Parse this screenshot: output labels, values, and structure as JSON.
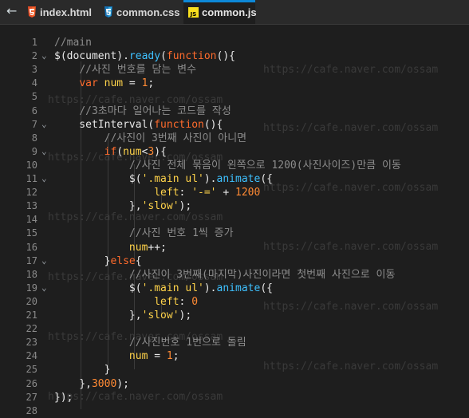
{
  "tabs": [
    {
      "label": "index.html",
      "icon": "html5-icon"
    },
    {
      "label": "common.css",
      "icon": "css3-icon"
    },
    {
      "label": "common.js",
      "icon": "js-icon",
      "active": true
    }
  ],
  "watermark": "https://cafe.naver.com/ossam",
  "lines": [
    {
      "n": "1",
      "tokens": [
        [
          "c",
          "//main"
        ]
      ]
    },
    {
      "n": "2",
      "fold": true,
      "tokens": [
        [
          "p",
          "$(document)."
        ],
        [
          "f",
          "ready"
        ],
        [
          "p",
          "("
        ],
        [
          "k",
          "function"
        ],
        [
          "p",
          "(){"
        ]
      ]
    },
    {
      "n": "3",
      "tokens": [
        [
          "p",
          "    "
        ],
        [
          "c",
          "//사진 번호를 담는 변수"
        ]
      ]
    },
    {
      "n": "4",
      "tokens": [
        [
          "p",
          "    "
        ],
        [
          "k",
          "var"
        ],
        [
          "p",
          " "
        ],
        [
          "i",
          "num"
        ],
        [
          "p",
          " = "
        ],
        [
          "n",
          "1"
        ],
        [
          "p",
          ";"
        ]
      ]
    },
    {
      "n": "5",
      "tokens": []
    },
    {
      "n": "6",
      "tokens": [
        [
          "p",
          "    "
        ],
        [
          "c",
          "//3초마다 일어나는 코드를 작성"
        ]
      ]
    },
    {
      "n": "7",
      "fold": true,
      "tokens": [
        [
          "p",
          "    setInterval("
        ],
        [
          "k",
          "function"
        ],
        [
          "p",
          "(){"
        ]
      ]
    },
    {
      "n": "8",
      "tokens": [
        [
          "p",
          "        "
        ],
        [
          "c",
          "//사진이 3번째 사진이 아니면"
        ]
      ]
    },
    {
      "n": "9",
      "fold": true,
      "tokens": [
        [
          "p",
          "        "
        ],
        [
          "k",
          "if"
        ],
        [
          "p",
          "("
        ],
        [
          "i",
          "num"
        ],
        [
          "p",
          "<"
        ],
        [
          "n",
          "3"
        ],
        [
          "p",
          "){"
        ]
      ]
    },
    {
      "n": "10",
      "tokens": [
        [
          "p",
          "            "
        ],
        [
          "c",
          "//사진 전체 묶음이 왼쪽으로 1200(사진사이즈)만큼 이동"
        ]
      ]
    },
    {
      "n": "11",
      "fold": true,
      "tokens": [
        [
          "p",
          "            $("
        ],
        [
          "s",
          "'.main ul'"
        ],
        [
          "p",
          ")."
        ],
        [
          "f",
          "animate"
        ],
        [
          "p",
          "({"
        ]
      ]
    },
    {
      "n": "12",
      "tokens": [
        [
          "p",
          "                "
        ],
        [
          "i",
          "left"
        ],
        [
          "p",
          ": "
        ],
        [
          "s",
          "'-='"
        ],
        [
          "p",
          " + "
        ],
        [
          "n",
          "1200"
        ]
      ]
    },
    {
      "n": "13",
      "tokens": [
        [
          "p",
          "            },"
        ],
        [
          "s",
          "'slow'"
        ],
        [
          "p",
          ");"
        ]
      ]
    },
    {
      "n": "14",
      "tokens": []
    },
    {
      "n": "15",
      "tokens": [
        [
          "p",
          "            "
        ],
        [
          "c",
          "//사진 번호 1씩 증가"
        ]
      ]
    },
    {
      "n": "16",
      "tokens": [
        [
          "p",
          "            "
        ],
        [
          "i",
          "num"
        ],
        [
          "p",
          "++;"
        ]
      ]
    },
    {
      "n": "17",
      "fold": true,
      "tokens": [
        [
          "p",
          "        }"
        ],
        [
          "k",
          "else"
        ],
        [
          "p",
          "{"
        ]
      ]
    },
    {
      "n": "18",
      "tokens": [
        [
          "p",
          "            "
        ],
        [
          "c",
          "//사진이 3번째(마지막)사진이라면 첫번째 사진으로 이동"
        ]
      ]
    },
    {
      "n": "19",
      "fold": true,
      "tokens": [
        [
          "p",
          "            $("
        ],
        [
          "s",
          "'.main ul'"
        ],
        [
          "p",
          ")."
        ],
        [
          "f",
          "animate"
        ],
        [
          "p",
          "({"
        ]
      ]
    },
    {
      "n": "20",
      "tokens": [
        [
          "p",
          "                "
        ],
        [
          "i",
          "left"
        ],
        [
          "p",
          ": "
        ],
        [
          "n",
          "0"
        ]
      ]
    },
    {
      "n": "21",
      "tokens": [
        [
          "p",
          "            },"
        ],
        [
          "s",
          "'slow'"
        ],
        [
          "p",
          ");"
        ]
      ]
    },
    {
      "n": "22",
      "tokens": []
    },
    {
      "n": "23",
      "tokens": [
        [
          "p",
          "            "
        ],
        [
          "c",
          "//사진번호 1번으로 돌림"
        ]
      ]
    },
    {
      "n": "24",
      "tokens": [
        [
          "p",
          "            "
        ],
        [
          "i",
          "num"
        ],
        [
          "p",
          " = "
        ],
        [
          "n",
          "1"
        ],
        [
          "p",
          ";"
        ]
      ]
    },
    {
      "n": "25",
      "tokens": [
        [
          "p",
          "        }"
        ]
      ]
    },
    {
      "n": "26",
      "tokens": [
        [
          "p",
          "    },"
        ],
        [
          "n",
          "3000"
        ],
        [
          "p",
          ");"
        ]
      ]
    },
    {
      "n": "27",
      "tokens": [
        [
          "p",
          "});"
        ]
      ]
    },
    {
      "n": "28",
      "tokens": []
    }
  ]
}
